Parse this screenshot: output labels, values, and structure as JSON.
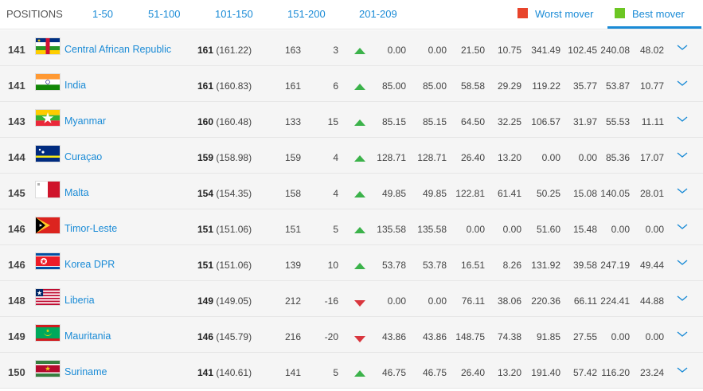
{
  "header": {
    "positions_label": "POSITIONS",
    "tabs": [
      "1-50",
      "51-100",
      "101-150",
      "151-200",
      "201-209"
    ],
    "worst_mover_label": "Worst mover",
    "best_mover_label": "Best mover",
    "colors": {
      "worst": "#e8442b",
      "best": "#6cc623",
      "accent": "#1a8bd6"
    }
  },
  "rows": [
    {
      "rank": "141",
      "country": "Central African Republic",
      "flag": "car",
      "points": "161",
      "points_precise": "(161.22)",
      "prev_points": "163",
      "change": "3",
      "dir": "up",
      "c1": "0.00",
      "c2": "0.00",
      "c3": "21.50",
      "c4": "10.75",
      "c5": "341.49",
      "c6": "102.45",
      "c7": "240.08",
      "c8": "48.02"
    },
    {
      "rank": "141",
      "country": "India",
      "flag": "india",
      "points": "161",
      "points_precise": "(160.83)",
      "prev_points": "161",
      "change": "6",
      "dir": "up",
      "c1": "85.00",
      "c2": "85.00",
      "c3": "58.58",
      "c4": "29.29",
      "c5": "119.22",
      "c6": "35.77",
      "c7": "53.87",
      "c8": "10.77"
    },
    {
      "rank": "143",
      "country": "Myanmar",
      "flag": "myanmar",
      "points": "160",
      "points_precise": "(160.48)",
      "prev_points": "133",
      "change": "15",
      "dir": "up",
      "c1": "85.15",
      "c2": "85.15",
      "c3": "64.50",
      "c4": "32.25",
      "c5": "106.57",
      "c6": "31.97",
      "c7": "55.53",
      "c8": "11.11"
    },
    {
      "rank": "144",
      "country": "Curaçao",
      "flag": "curacao",
      "points": "159",
      "points_precise": "(158.98)",
      "prev_points": "159",
      "change": "4",
      "dir": "up",
      "c1": "128.71",
      "c2": "128.71",
      "c3": "26.40",
      "c4": "13.20",
      "c5": "0.00",
      "c6": "0.00",
      "c7": "85.36",
      "c8": "17.07"
    },
    {
      "rank": "145",
      "country": "Malta",
      "flag": "malta",
      "points": "154",
      "points_precise": "(154.35)",
      "prev_points": "158",
      "change": "4",
      "dir": "up",
      "c1": "49.85",
      "c2": "49.85",
      "c3": "122.81",
      "c4": "61.41",
      "c5": "50.25",
      "c6": "15.08",
      "c7": "140.05",
      "c8": "28.01"
    },
    {
      "rank": "146",
      "country": "Timor-Leste",
      "flag": "timor",
      "points": "151",
      "points_precise": "(151.06)",
      "prev_points": "151",
      "change": "5",
      "dir": "up",
      "c1": "135.58",
      "c2": "135.58",
      "c3": "0.00",
      "c4": "0.00",
      "c5": "51.60",
      "c6": "15.48",
      "c7": "0.00",
      "c8": "0.00"
    },
    {
      "rank": "146",
      "country": "Korea DPR",
      "flag": "korea",
      "points": "151",
      "points_precise": "(151.06)",
      "prev_points": "139",
      "change": "10",
      "dir": "up",
      "c1": "53.78",
      "c2": "53.78",
      "c3": "16.51",
      "c4": "8.26",
      "c5": "131.92",
      "c6": "39.58",
      "c7": "247.19",
      "c8": "49.44"
    },
    {
      "rank": "148",
      "country": "Liberia",
      "flag": "liberia",
      "points": "149",
      "points_precise": "(149.05)",
      "prev_points": "212",
      "change": "-16",
      "dir": "down",
      "c1": "0.00",
      "c2": "0.00",
      "c3": "76.11",
      "c4": "38.06",
      "c5": "220.36",
      "c6": "66.11",
      "c7": "224.41",
      "c8": "44.88"
    },
    {
      "rank": "149",
      "country": "Mauritania",
      "flag": "mauritania",
      "points": "146",
      "points_precise": "(145.79)",
      "prev_points": "216",
      "change": "-20",
      "dir": "down",
      "c1": "43.86",
      "c2": "43.86",
      "c3": "148.75",
      "c4": "74.38",
      "c5": "91.85",
      "c6": "27.55",
      "c7": "0.00",
      "c8": "0.00"
    },
    {
      "rank": "150",
      "country": "Suriname",
      "flag": "suriname",
      "points": "141",
      "points_precise": "(140.61)",
      "prev_points": "141",
      "change": "5",
      "dir": "up",
      "c1": "46.75",
      "c2": "46.75",
      "c3": "26.40",
      "c4": "13.20",
      "c5": "191.40",
      "c6": "57.42",
      "c7": "116.20",
      "c8": "23.24"
    }
  ]
}
